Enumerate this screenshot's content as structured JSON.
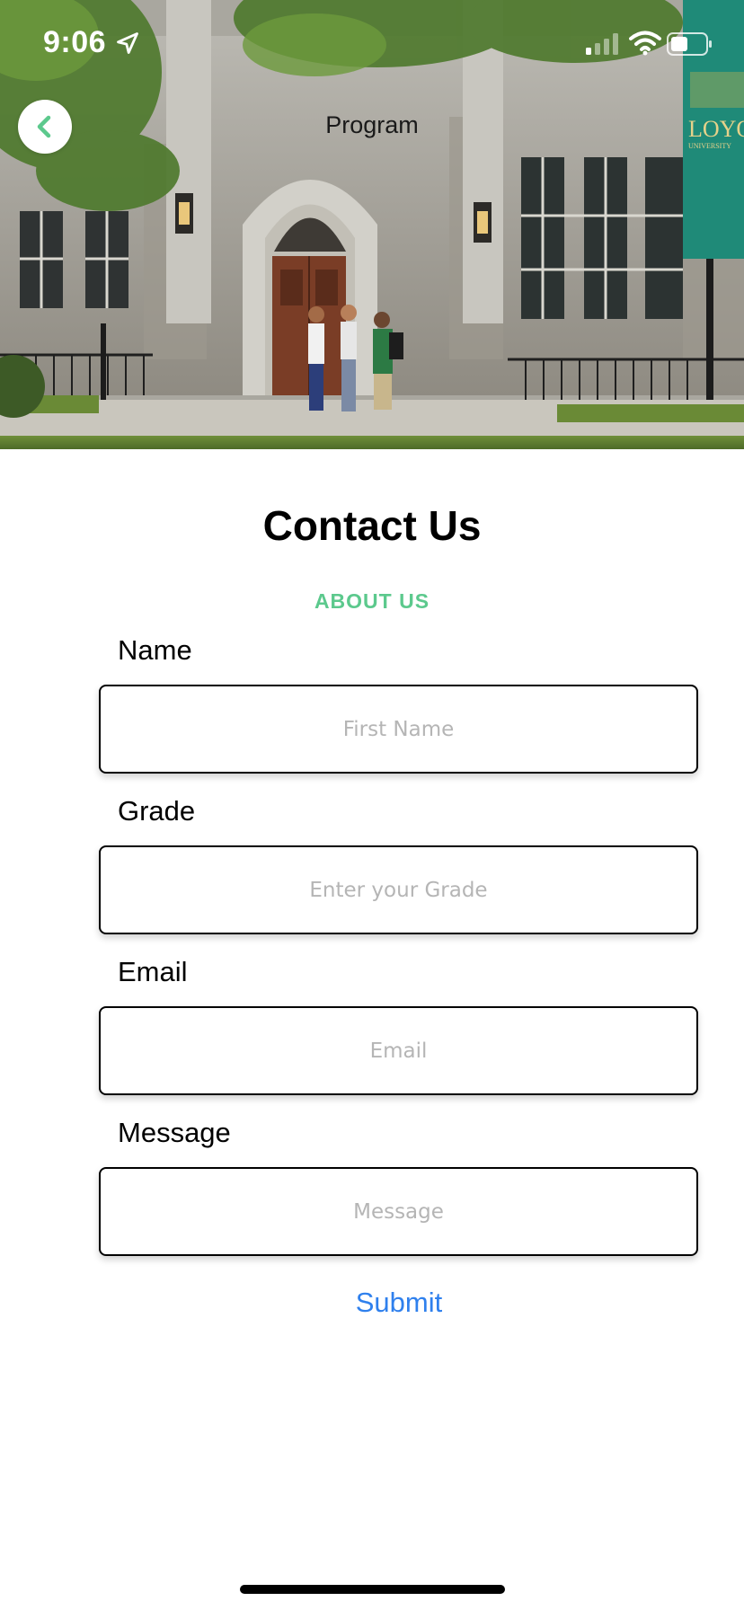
{
  "status_bar": {
    "time": "9:06",
    "icons": [
      "location-arrow-icon",
      "cellular-signal-icon",
      "wifi-icon",
      "battery-icon"
    ]
  },
  "nav": {
    "title": "Program",
    "back_icon": "chevron-left-icon"
  },
  "hero": {
    "banner_text": "LOYO",
    "banner_subtext": "UNIVERSITY",
    "accent_color": "#1f8a78"
  },
  "page": {
    "title": "Contact Us",
    "section_link": "ABOUT US"
  },
  "form": {
    "fields": [
      {
        "label": "Name",
        "placeholder": "First Name"
      },
      {
        "label": "Grade",
        "placeholder": "Enter your Grade"
      },
      {
        "label": "Email",
        "placeholder": "Email"
      },
      {
        "label": "Message",
        "placeholder": "Message"
      }
    ],
    "submit_label": "Submit"
  },
  "colors": {
    "accent_green": "#5cc98d",
    "link_blue": "#2f80ed"
  }
}
